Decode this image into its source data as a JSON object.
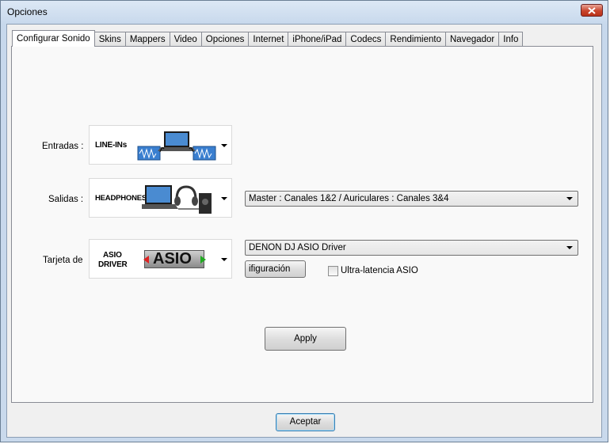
{
  "window": {
    "title": "Opciones"
  },
  "tabs": [
    {
      "label": "Configurar Sonido",
      "active": true
    },
    {
      "label": "Skins"
    },
    {
      "label": "Mappers"
    },
    {
      "label": "Video"
    },
    {
      "label": "Opciones"
    },
    {
      "label": "Internet"
    },
    {
      "label": "iPhone/iPad"
    },
    {
      "label": "Codecs"
    },
    {
      "label": "Rendimiento"
    },
    {
      "label": "Navegador"
    },
    {
      "label": "Info"
    }
  ],
  "sound": {
    "inputs_label": "Entradas :",
    "inputs_image_caption": "LINE-INs",
    "outputs_label": "Salidas :",
    "outputs_image_caption": "HEADPHONES",
    "outputs_combo_value": "Master : Canales 1&2 / Auriculares : Canales 3&4",
    "card_label": "Tarjeta de",
    "card_image_caption_1": "ASIO",
    "card_image_caption_2": "DRIVER",
    "card_logo_text": "ASIO",
    "card_combo_value": "DENON DJ ASIO Driver",
    "asio_config_button": "ifiguración ASI",
    "ultra_latency_label": "Ultra-latencia ASIO",
    "ultra_latency_checked": false,
    "apply_button": "Apply"
  },
  "footer": {
    "accept_button": "Aceptar"
  },
  "colors": {
    "titlebar": "#c9d9ec",
    "close_button": "#c9452d",
    "panel": "#f9f9f9",
    "waveform": "#3a7fd0"
  }
}
